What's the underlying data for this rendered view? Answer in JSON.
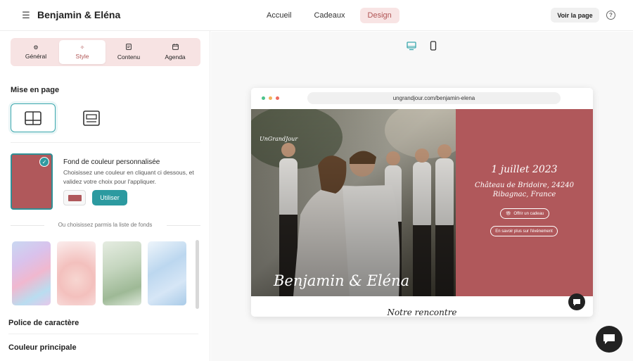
{
  "header": {
    "title": "Benjamin & Eléna",
    "nav": [
      "Accueil",
      "Cadeaux",
      "Design"
    ],
    "view_page": "Voir la page",
    "help": "?"
  },
  "sidebar": {
    "tabs": [
      {
        "label": "Général",
        "icon": "gear-icon"
      },
      {
        "label": "Style",
        "icon": "sparkles-icon"
      },
      {
        "label": "Contenu",
        "icon": "document-icon"
      },
      {
        "label": "Agenda",
        "icon": "calendar-icon"
      }
    ],
    "layout_title": "Mise en page",
    "background": {
      "title": "Fond de couleur personnalisée",
      "desc": "Choisissez une couleur en cliquant ci dessous, et validez votre choix pour l'appliquer.",
      "use_button": "Utiliser",
      "color": "#b0585b"
    },
    "or_text": "Ou choisissez parmis la liste de fonds",
    "font_title": "Police de caractère",
    "main_color_title": "Couleur principale"
  },
  "preview": {
    "url": "ungrandjour.com/benjamin-elena",
    "logo": "UnGrandJour",
    "couple": "Benjamin & Eléna",
    "date": "1 juillet 2023",
    "place_line1": "Château de Bridoire, 24240",
    "place_line2": "Ribagnac, France",
    "gift_button": "Offrir un cadeau",
    "more_button": "En savoir plus sur l'événement",
    "story_title": "Notre rencontre"
  },
  "colors": {
    "accent": "#2c9aa0",
    "brand": "#b0585b",
    "tab_bg": "#f7e3e3"
  }
}
